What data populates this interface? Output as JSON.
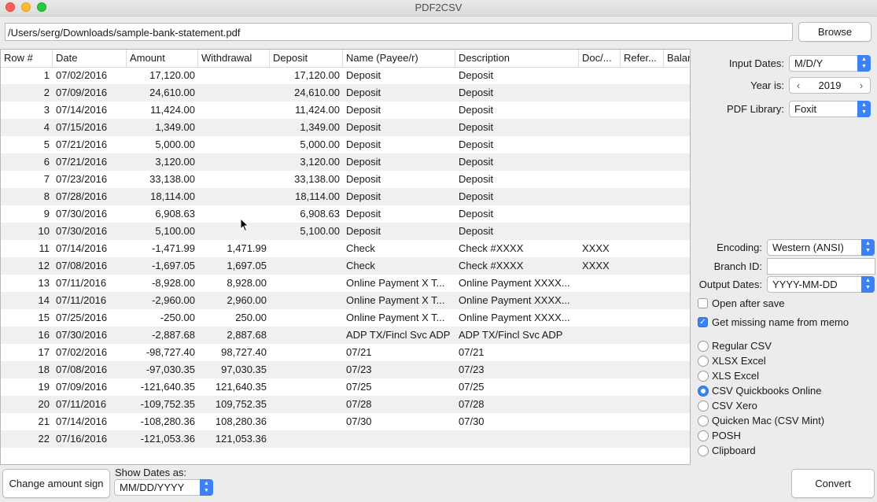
{
  "window": {
    "title": "PDF2CSV"
  },
  "file": {
    "path": "/Users/serg/Downloads/sample-bank-statement.pdf",
    "browse_label": "Browse"
  },
  "table": {
    "columns": [
      "Row #",
      "Date",
      "Amount",
      "Withdrawal",
      "Deposit",
      "Name (Payee/r)",
      "Description",
      "Doc/...",
      "Refer...",
      "Balar"
    ],
    "rows": [
      [
        "1",
        "07/02/2016",
        "17,120.00",
        "",
        "17,120.00",
        "Deposit",
        "Deposit",
        "",
        ""
      ],
      [
        "2",
        "07/09/2016",
        "24,610.00",
        "",
        "24,610.00",
        "Deposit",
        "Deposit",
        "",
        ""
      ],
      [
        "3",
        "07/14/2016",
        "11,424.00",
        "",
        "11,424.00",
        "Deposit",
        "Deposit",
        "",
        ""
      ],
      [
        "4",
        "07/15/2016",
        "1,349.00",
        "",
        "1,349.00",
        "Deposit",
        "Deposit",
        "",
        ""
      ],
      [
        "5",
        "07/21/2016",
        "5,000.00",
        "",
        "5,000.00",
        "Deposit",
        "Deposit",
        "",
        ""
      ],
      [
        "6",
        "07/21/2016",
        "3,120.00",
        "",
        "3,120.00",
        "Deposit",
        "Deposit",
        "",
        ""
      ],
      [
        "7",
        "07/23/2016",
        "33,138.00",
        "",
        "33,138.00",
        "Deposit",
        "Deposit",
        "",
        ""
      ],
      [
        "8",
        "07/28/2016",
        "18,114.00",
        "",
        "18,114.00",
        "Deposit",
        "Deposit",
        "",
        ""
      ],
      [
        "9",
        "07/30/2016",
        "6,908.63",
        "",
        "6,908.63",
        "Deposit",
        "Deposit",
        "",
        ""
      ],
      [
        "10",
        "07/30/2016",
        "5,100.00",
        "",
        "5,100.00",
        "Deposit",
        "Deposit",
        "",
        ""
      ],
      [
        "11",
        "07/14/2016",
        "-1,471.99",
        "1,471.99",
        "",
        "Check",
        "Check #XXXX",
        "XXXX",
        ""
      ],
      [
        "12",
        "07/08/2016",
        "-1,697.05",
        "1,697.05",
        "",
        "Check",
        "Check #XXXX",
        "XXXX",
        ""
      ],
      [
        "13",
        "07/11/2016",
        "-8,928.00",
        "8,928.00",
        "",
        "Online Payment X T...",
        "Online Payment XXXX...",
        "",
        ""
      ],
      [
        "14",
        "07/11/2016",
        "-2,960.00",
        "2,960.00",
        "",
        "Online Payment X T...",
        "Online Payment XXXX...",
        "",
        ""
      ],
      [
        "15",
        "07/25/2016",
        "-250.00",
        "250.00",
        "",
        "Online Payment X T...",
        "Online Payment XXXX...",
        "",
        ""
      ],
      [
        "16",
        "07/30/2016",
        "-2,887.68",
        "2,887.68",
        "",
        "ADP TX/Fincl Svc ADP",
        "ADP TX/Fincl Svc ADP",
        "",
        ""
      ],
      [
        "17",
        "07/02/2016",
        "-98,727.40",
        "98,727.40",
        "",
        "07/21",
        "07/21",
        "",
        ""
      ],
      [
        "18",
        "07/08/2016",
        "-97,030.35",
        "97,030.35",
        "",
        "07/23",
        "07/23",
        "",
        ""
      ],
      [
        "19",
        "07/09/2016",
        "-121,640.35",
        "121,640.35",
        "",
        "07/25",
        "07/25",
        "",
        ""
      ],
      [
        "20",
        "07/11/2016",
        "-109,752.35",
        "109,752.35",
        "",
        "07/28",
        "07/28",
        "",
        ""
      ],
      [
        "21",
        "07/14/2016",
        "-108,280.36",
        "108,280.36",
        "",
        "07/30",
        "07/30",
        "",
        ""
      ],
      [
        "22",
        "07/16/2016",
        "-121,053.36",
        "121,053.36",
        "",
        "",
        "",
        "",
        ""
      ]
    ]
  },
  "options": {
    "input_dates_label": "Input Dates:",
    "input_dates_value": "M/D/Y",
    "year_label": "Year is:",
    "year_value": "2019",
    "pdf_library_label": "PDF Library:",
    "pdf_library_value": "Foxit",
    "encoding_label": "Encoding:",
    "encoding_value": "Western (ANSI)",
    "branch_label": "Branch ID:",
    "branch_value": "",
    "output_dates_label": "Output Dates:",
    "output_dates_value": "YYYY-MM-DD",
    "open_after_save_label": "Open after save",
    "open_after_save": false,
    "missing_name_label": "Get missing name from memo",
    "missing_name": true
  },
  "formats": [
    {
      "label": "Regular CSV",
      "selected": false
    },
    {
      "label": "XLSX Excel",
      "selected": false
    },
    {
      "label": "XLS Excel",
      "selected": false
    },
    {
      "label": "CSV Quickbooks Online",
      "selected": true
    },
    {
      "label": "CSV Xero",
      "selected": false
    },
    {
      "label": "Quicken Mac (CSV Mint)",
      "selected": false
    },
    {
      "label": "POSH",
      "selected": false
    },
    {
      "label": "Clipboard",
      "selected": false
    }
  ],
  "bottom": {
    "change_sign_label": "Change amount sign",
    "show_dates_label": "Show Dates as:",
    "show_dates_value": "MM/DD/YYYY",
    "convert_label": "Convert"
  },
  "colors": {
    "accent": "#3b82f6",
    "row_alt": "#f0f0f0"
  }
}
